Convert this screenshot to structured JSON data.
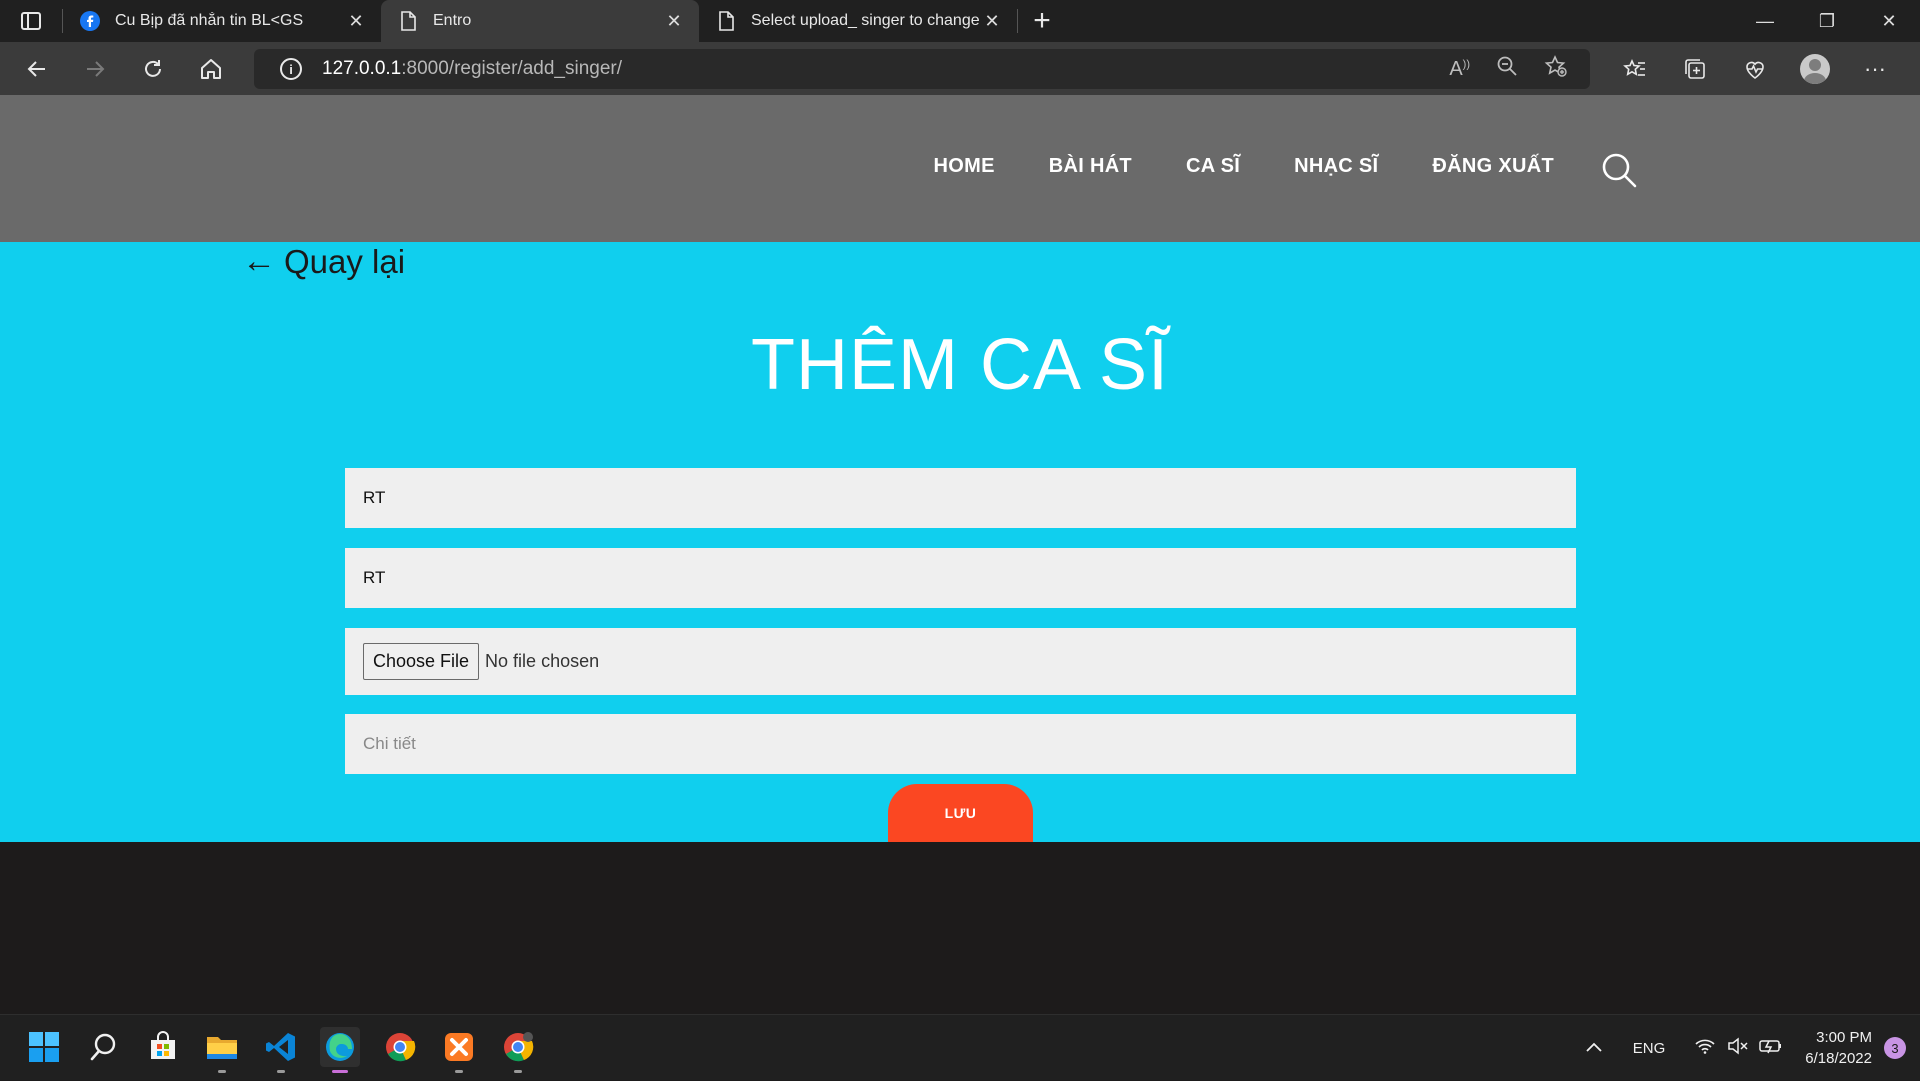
{
  "browser": {
    "tabs": [
      {
        "title": "Cu Bịp đã nhắn tin BL<GS",
        "icon": "facebook-icon",
        "active": false
      },
      {
        "title": "Entro",
        "icon": "page-icon",
        "active": true
      },
      {
        "title": "Select upload_ singer to change",
        "icon": "page-icon",
        "active": false
      }
    ],
    "url_host": "127.0.0.1",
    "url_path": ":8000/register/add_singer/"
  },
  "site": {
    "nav": [
      "HOME",
      "BÀI HÁT",
      "CA SĨ",
      "NHẠC SĨ",
      "ĐĂNG XUẤT"
    ],
    "back_label": "Quay lại",
    "back_arrow": "←",
    "heading": "THÊM CA SĨ",
    "form": {
      "name_value": "RT",
      "second_value": "RT",
      "file_button": "Choose File",
      "file_status": "No file chosen",
      "detail_placeholder": "Chi tiết",
      "save_label": "LƯU"
    }
  },
  "taskbar": {
    "tray_language": "ENG",
    "time": "3:00 PM",
    "date": "6/18/2022",
    "notification_count": "3"
  },
  "colors": {
    "content_bg": "#10cfee",
    "header_bg": "#6a6a6a",
    "save_button": "#fb4722",
    "field_bg": "#efefef"
  }
}
